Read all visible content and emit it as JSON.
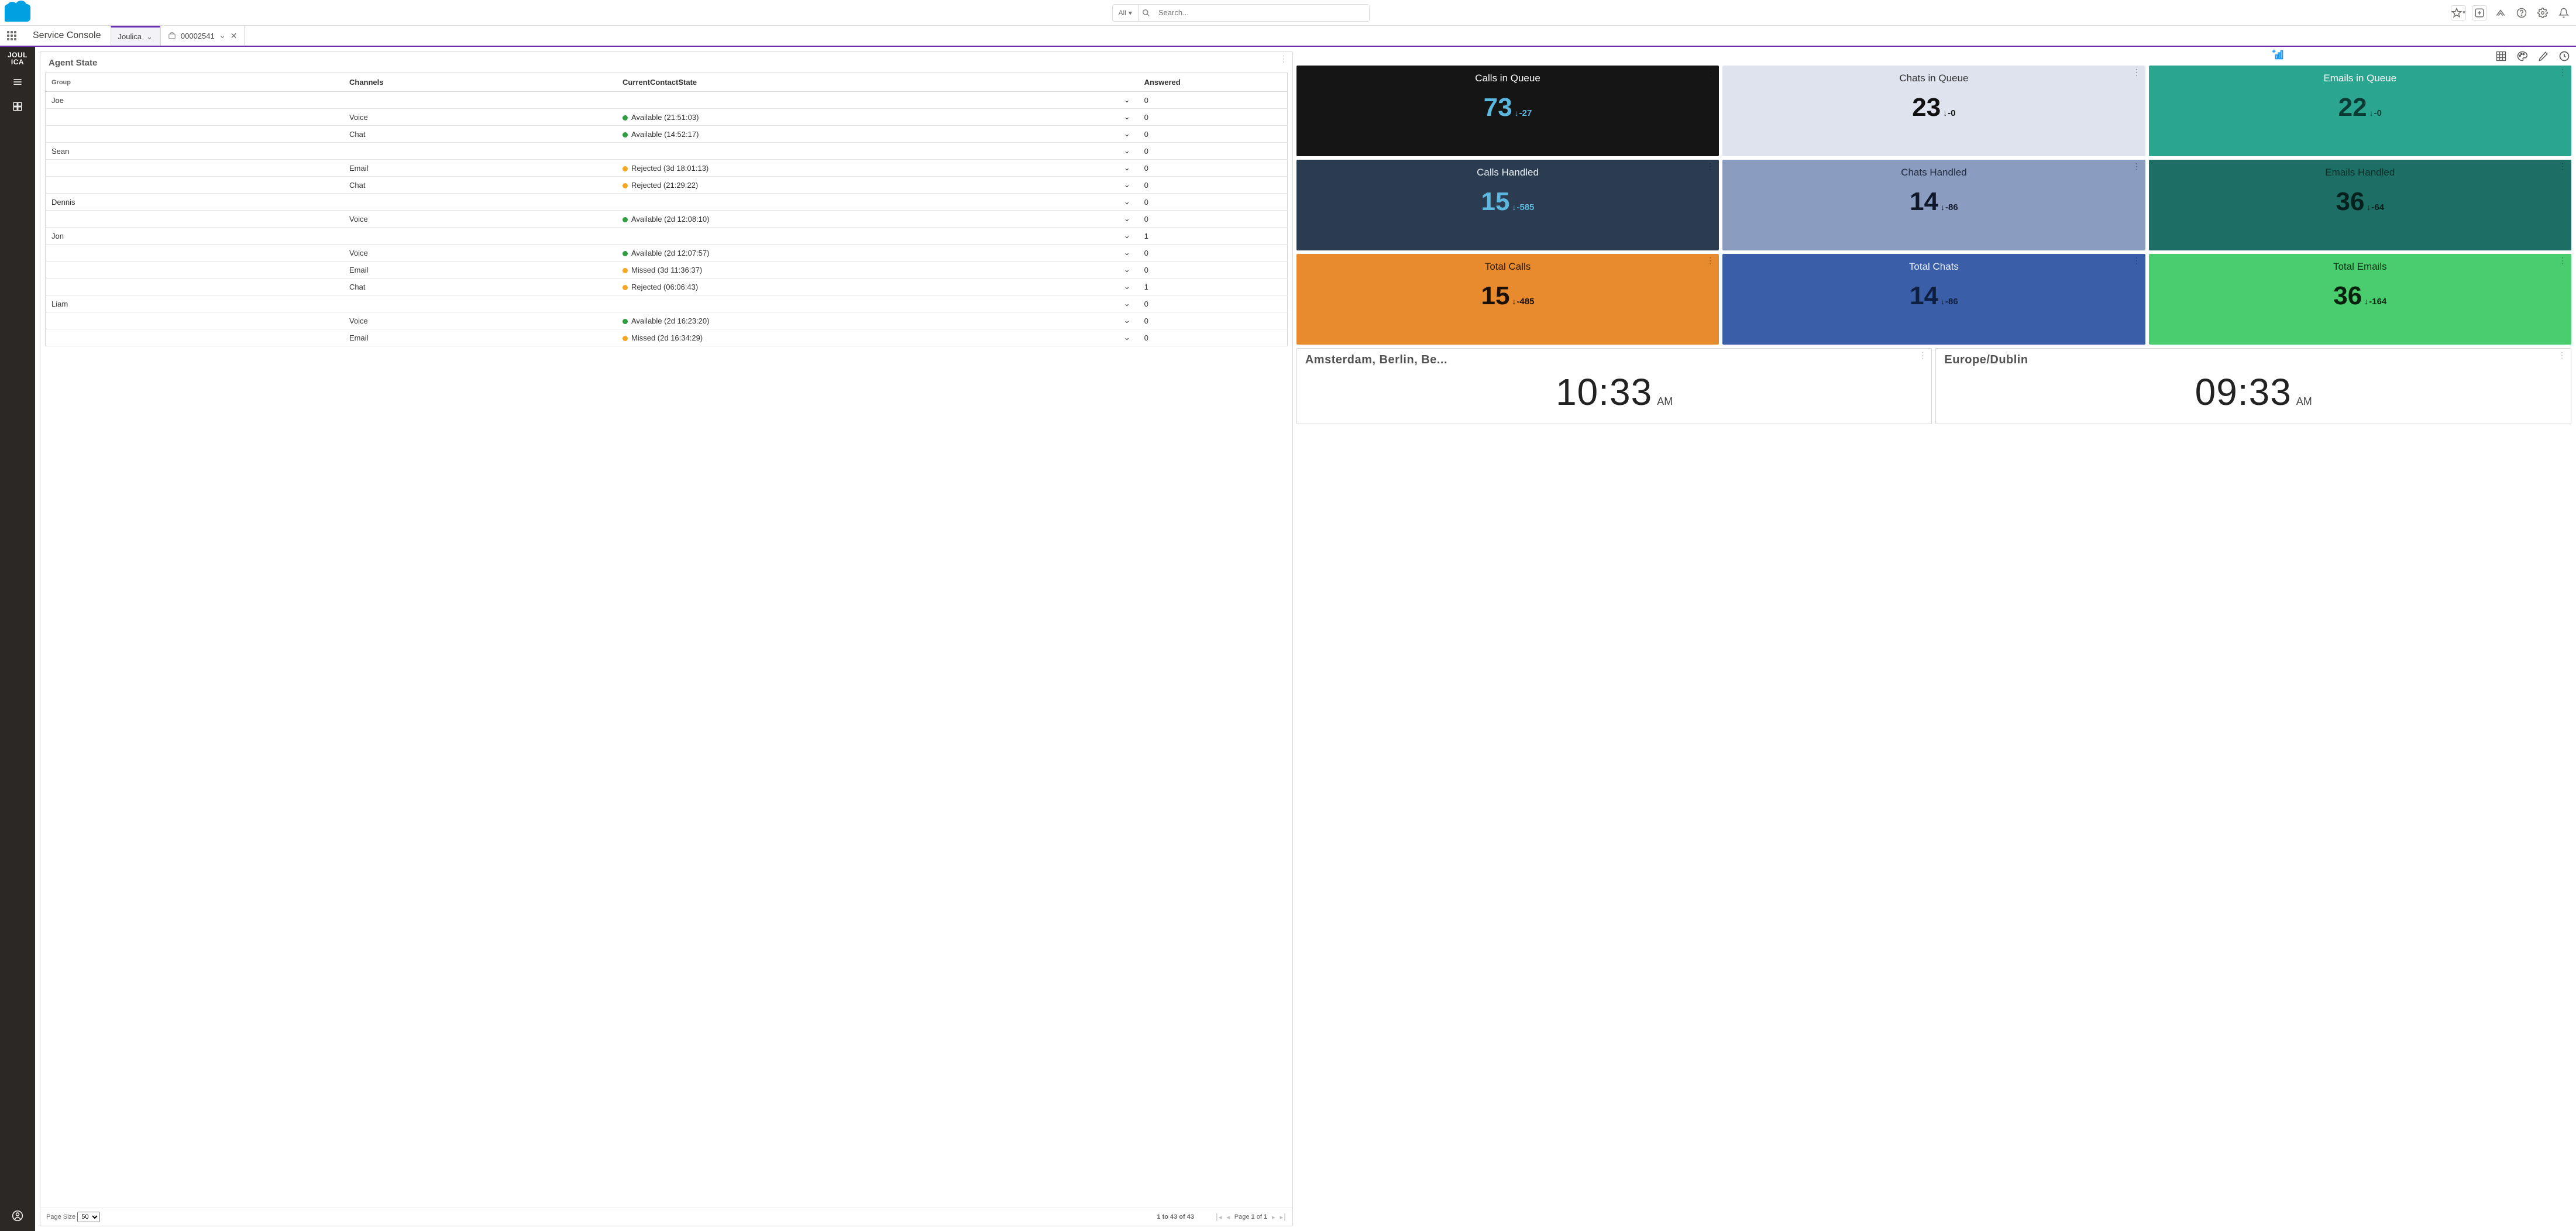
{
  "header": {
    "search_scope": "All",
    "search_placeholder": "Search..."
  },
  "nav": {
    "app_name": "Service Console",
    "tabs": [
      {
        "label": "Joulica",
        "active": true,
        "closable": false
      },
      {
        "label": "00002541",
        "active": false,
        "closable": true
      }
    ]
  },
  "left_rail": {
    "brand": "JOUL\nICA"
  },
  "agent_panel": {
    "title": "Agent State",
    "columns": {
      "group": "Group",
      "channels": "Channels",
      "state": "CurrentContactState",
      "answered": "Answered"
    },
    "rows": [
      {
        "type": "group",
        "name": "Joe",
        "answered": "0"
      },
      {
        "type": "channel",
        "channel": "Voice",
        "status": "Available",
        "duration": "(21:51:03)",
        "dot": "green",
        "answered": "0"
      },
      {
        "type": "channel",
        "channel": "Chat",
        "status": "Available",
        "duration": "(14:52:17)",
        "dot": "green",
        "answered": "0"
      },
      {
        "type": "group",
        "name": "Sean",
        "answered": "0"
      },
      {
        "type": "channel",
        "channel": "Email",
        "status": "Rejected",
        "duration": "(3d 18:01:13)",
        "dot": "amber",
        "answered": "0"
      },
      {
        "type": "channel",
        "channel": "Chat",
        "status": "Rejected",
        "duration": "(21:29:22)",
        "dot": "amber",
        "answered": "0"
      },
      {
        "type": "group",
        "name": "Dennis",
        "answered": "0"
      },
      {
        "type": "channel",
        "channel": "Voice",
        "status": "Available",
        "duration": "(2d 12:08:10)",
        "dot": "green",
        "answered": "0"
      },
      {
        "type": "group",
        "name": "Jon",
        "answered": "1"
      },
      {
        "type": "channel",
        "channel": "Voice",
        "status": "Available",
        "duration": "(2d 12:07:57)",
        "dot": "green",
        "answered": "0"
      },
      {
        "type": "channel",
        "channel": "Email",
        "status": "Missed",
        "duration": "(3d 11:36:37)",
        "dot": "amber",
        "answered": "0"
      },
      {
        "type": "channel",
        "channel": "Chat",
        "status": "Rejected",
        "duration": "(06:06:43)",
        "dot": "amber",
        "answered": "1"
      },
      {
        "type": "group",
        "name": "Liam",
        "answered": "0"
      },
      {
        "type": "channel",
        "channel": "Voice",
        "status": "Available",
        "duration": "(2d 16:23:20)",
        "dot": "green",
        "answered": "0"
      },
      {
        "type": "channel",
        "channel": "Email",
        "status": "Missed",
        "duration": "(2d 16:34:29)",
        "dot": "amber",
        "answered": "0"
      }
    ],
    "footer": {
      "pagesize_label": "Page Size",
      "pagesize_value": "50",
      "range_text": "1 to 43 of 43",
      "page_text_pre": "Page ",
      "page_current": "1",
      "page_text_mid": " of ",
      "page_total": "1"
    }
  },
  "tiles": [
    {
      "title": "Calls in Queue",
      "value": "73",
      "delta": "-27",
      "theme": "t-black"
    },
    {
      "title": "Chats in Queue",
      "value": "23",
      "delta": "-0",
      "theme": "t-lav"
    },
    {
      "title": "Emails in Queue",
      "value": "22",
      "delta": "-0",
      "theme": "t-teal"
    },
    {
      "title": "Calls Handled",
      "value": "15",
      "delta": "-585",
      "theme": "t-navy"
    },
    {
      "title": "Chats Handled",
      "value": "14",
      "delta": "-86",
      "theme": "t-slate"
    },
    {
      "title": "Emails Handled",
      "value": "36",
      "delta": "-64",
      "theme": "t-tealD"
    },
    {
      "title": "Total Calls",
      "value": "15",
      "delta": "-485",
      "theme": "t-orange"
    },
    {
      "title": "Total Chats",
      "value": "14",
      "delta": "-86",
      "theme": "t-blue"
    },
    {
      "title": "Total Emails",
      "value": "36",
      "delta": "-164",
      "theme": "t-green"
    }
  ],
  "clocks": [
    {
      "title": "Amsterdam, Berlin, Be...",
      "time": "10:33",
      "ampm": "AM"
    },
    {
      "title": "Europe/Dublin",
      "time": "09:33",
      "ampm": "AM"
    }
  ]
}
